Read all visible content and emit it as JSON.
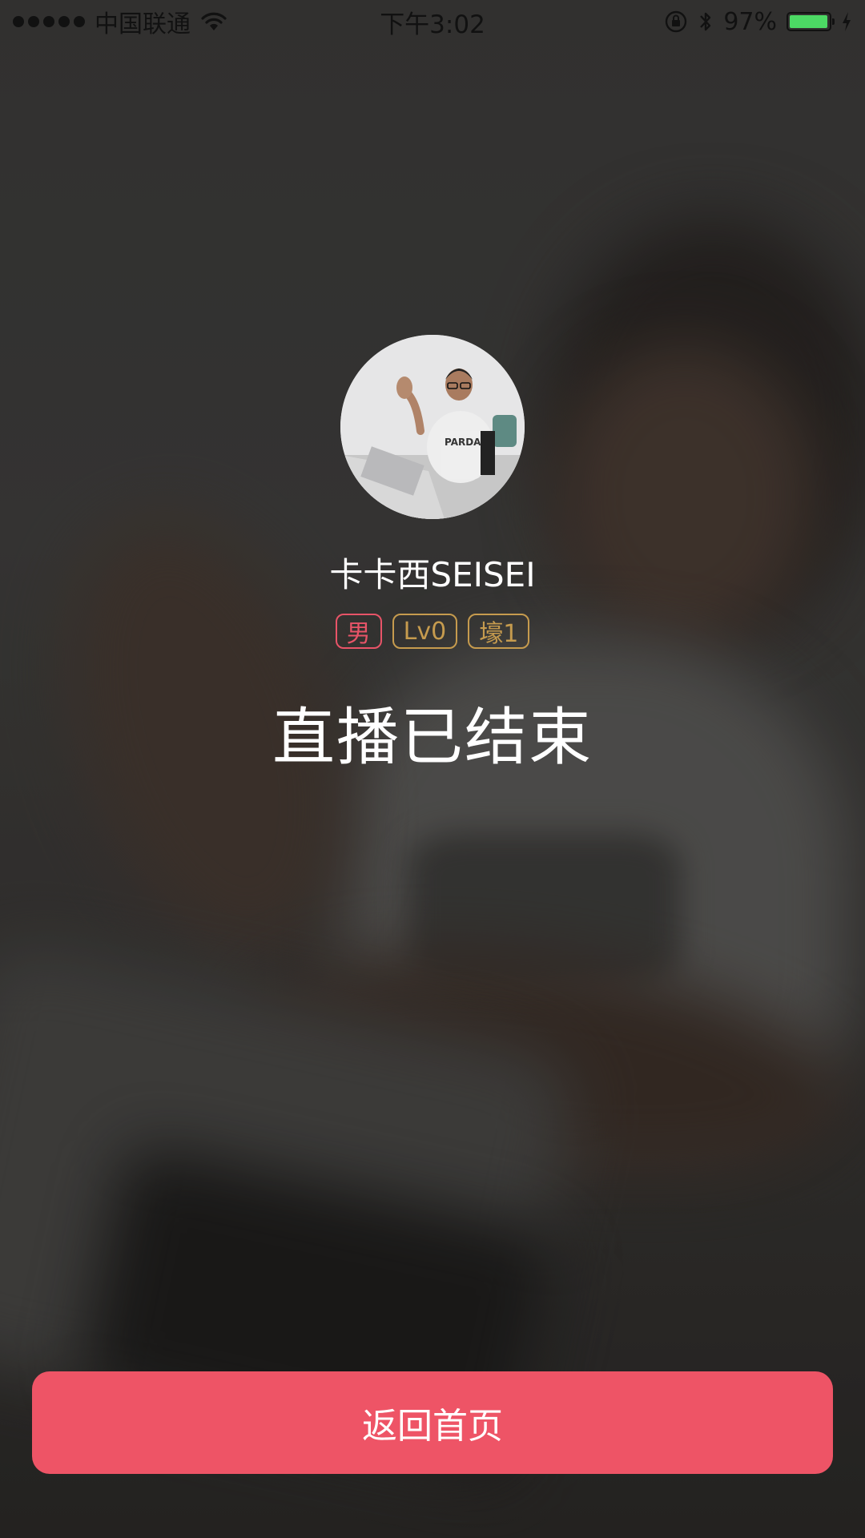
{
  "status_bar": {
    "carrier": "中国联通",
    "time": "下午3:02",
    "battery_percent": "97%",
    "battery_level": 0.97,
    "battery_fill_color": "#4cd964"
  },
  "profile": {
    "username": "卡卡西SEISEI",
    "tags": {
      "gender": "男",
      "level": "Lv0",
      "rich": "壕1"
    }
  },
  "main": {
    "ended_title": "直播已结束"
  },
  "footer": {
    "home_button_label": "返回首页"
  },
  "colors": {
    "accent": "#ee5466",
    "gender_tag": "#e85468",
    "gold_tag": "#c69b4e"
  }
}
